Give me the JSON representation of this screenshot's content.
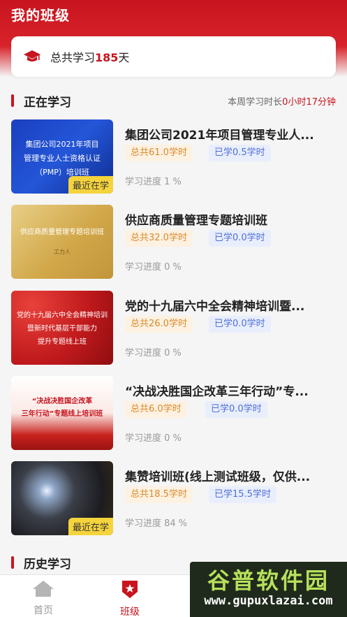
{
  "header": {
    "title": "我的班级"
  },
  "summary": {
    "prefix": "总共学习",
    "days": "185",
    "suffix": "天",
    "icon": "graduation-cap-icon"
  },
  "current": {
    "title": "正在学习",
    "weekly_prefix": "本周学习时长",
    "weekly_value": "0小时17分钟"
  },
  "courses": [
    {
      "title": "集团公司2021年项目管理专业人...",
      "total": "总共61.0学时",
      "done": "已学0.5学时",
      "progress": "学习进度 1 %",
      "thumb_text": [
        "集团公司2021年项目",
        "管理专业人士资格认证",
        "（PMP）培训班"
      ],
      "recent": "最近在学"
    },
    {
      "title": "供应商质量管理专题培训班",
      "total": "总共32.0学时",
      "done": "已学0.0学时",
      "progress": "学习进度 0 %",
      "thumb_text": [
        "供应商质量管理专题培训班",
        "工力人"
      ]
    },
    {
      "title": "党的十九届六中全会精神培训暨...",
      "total": "总共26.0学时",
      "done": "已学0.0学时",
      "progress": "学习进度 0 %",
      "thumb_text": [
        "党的十九届六中全会精神培训",
        "暨新时代基层干部能力",
        "提升专题线上班"
      ]
    },
    {
      "title": "“决战决胜国企改革三年行动”专...",
      "total": "总共6.0学时",
      "done": "已学0.0学时",
      "progress": "学习进度 0 %",
      "thumb_text": [
        "“决战决胜国企改革",
        "三年行动”专题线上培训班"
      ]
    },
    {
      "title": "集赞培训班(线上测试班级，仅供...",
      "total": "总共18.5学时",
      "done": "已学15.5学时",
      "progress": "学习进度 84 %",
      "recent": "最近在学"
    }
  ],
  "history": {
    "title": "历史学习"
  },
  "nav": {
    "home": "首页",
    "class": "班级"
  },
  "watermark": {
    "main": "谷普软件园",
    "url": "www.gupuxlazai.com"
  },
  "colors": {
    "primary": "#c8141e",
    "total_tag": "#d98b2b",
    "done_tag": "#4f6fd6"
  }
}
